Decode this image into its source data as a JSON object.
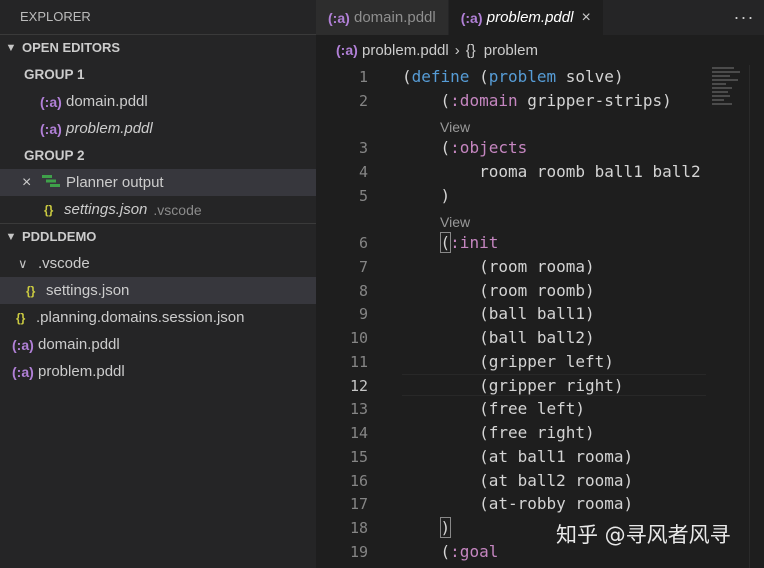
{
  "sidebar": {
    "title": "EXPLORER",
    "open_editors": {
      "label": "OPEN EDITORS",
      "group1": "GROUP 1",
      "group1_files": [
        "domain.pddl",
        "problem.pddl"
      ],
      "group2": "GROUP 2",
      "group2_items": {
        "planner": "Planner output",
        "settings": "settings.json",
        "settings_desc": ".vscode"
      }
    },
    "workspace": {
      "label": "PDDLDEMO",
      "folder": ".vscode",
      "folder_child": "settings.json",
      "files": [
        ".planning.domains.session.json",
        "domain.pddl",
        "problem.pddl"
      ]
    }
  },
  "icons": {
    "pddl_glyph": "(:a)",
    "json_glyph": "{}",
    "close_glyph": "×",
    "more_glyph": "···"
  },
  "tabs": [
    {
      "label": "domain.pddl",
      "active": false
    },
    {
      "label": "problem.pddl",
      "active": true
    }
  ],
  "breadcrumb": {
    "file": "problem.pddl",
    "symbol": "problem"
  },
  "code": {
    "lens_label": "View",
    "lines": [
      {
        "n": "1",
        "text": "(define (problem solve)"
      },
      {
        "n": "2",
        "text": "    (:domain gripper-strips)"
      },
      {
        "n": "3",
        "text": "    (:objects"
      },
      {
        "n": "4",
        "text": "        rooma roomb ball1 ball2"
      },
      {
        "n": "5",
        "text": "    )"
      },
      {
        "n": "6",
        "text": "    (:init"
      },
      {
        "n": "7",
        "text": "        (room rooma)"
      },
      {
        "n": "8",
        "text": "        (room roomb)"
      },
      {
        "n": "9",
        "text": "        (ball ball1)"
      },
      {
        "n": "10",
        "text": "        (ball ball2)"
      },
      {
        "n": "11",
        "text": "        (gripper left)"
      },
      {
        "n": "12",
        "text": "        (gripper right)"
      },
      {
        "n": "13",
        "text": "        (free left)"
      },
      {
        "n": "14",
        "text": "        (free right)"
      },
      {
        "n": "15",
        "text": "        (at ball1 rooma)"
      },
      {
        "n": "16",
        "text": "        (at ball2 rooma)"
      },
      {
        "n": "17",
        "text": "        (at-robby rooma)"
      },
      {
        "n": "18",
        "text": "    )"
      },
      {
        "n": "19",
        "text": "    (:goal"
      }
    ]
  },
  "watermark": "知乎 @寻风者风寻",
  "colors": {
    "keyword": "#569cd6",
    "colon_keyword": "#c586c0",
    "pddl_icon": "#b180d7",
    "json_icon": "#cbcb41",
    "planner_icon": "#3fa14a"
  }
}
